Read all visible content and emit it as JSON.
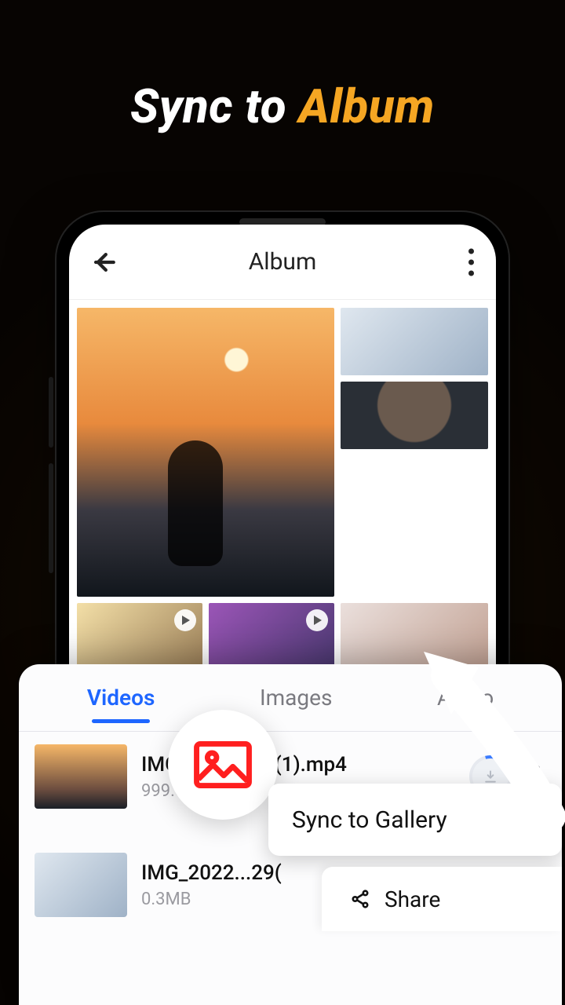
{
  "headline": {
    "prefix": "Sync to ",
    "accent": "Album"
  },
  "app": {
    "title": "Album",
    "tabs": [
      "Videos",
      "Images",
      "Audio"
    ],
    "active_tab": 0,
    "files": [
      {
        "name": "IMG_2022...29(1).mp4",
        "size": "999.5M"
      },
      {
        "name": "IMG_2022...29(",
        "size": "0.3MB"
      }
    ]
  },
  "popover": {
    "sync_label": "Sync to Gallery",
    "share_label": "Share"
  }
}
